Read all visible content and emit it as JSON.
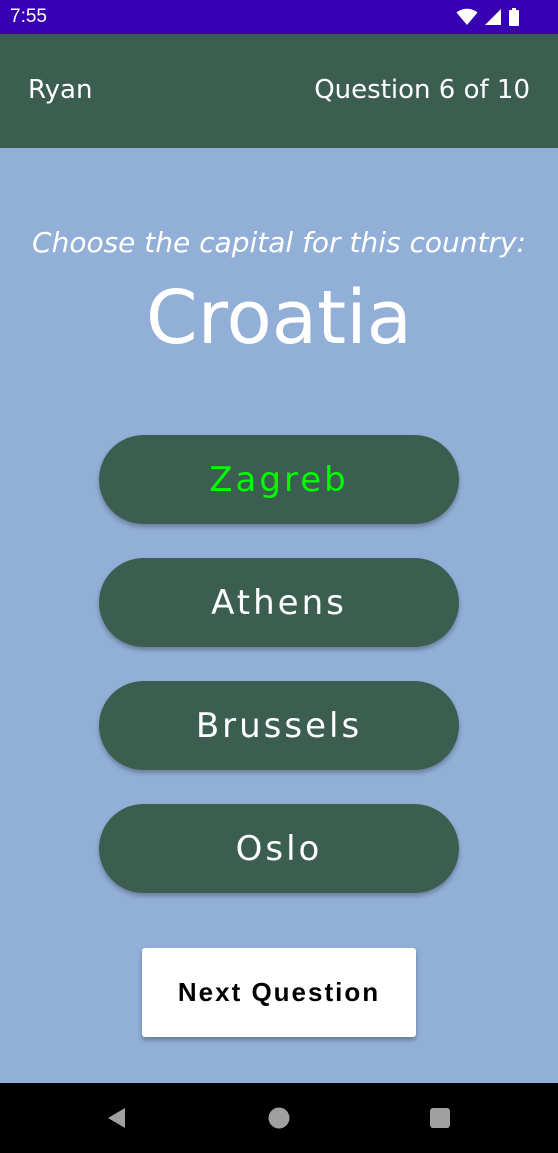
{
  "status_bar": {
    "time": "7:55",
    "icons": [
      "wifi-icon",
      "cell-signal-icon",
      "battery-icon"
    ]
  },
  "header": {
    "player_name": "Ryan",
    "progress": "Question 6 of 10"
  },
  "quiz": {
    "prompt": "Choose the capital for this country:",
    "country": "Croatia",
    "answers": [
      {
        "label": "Zagreb",
        "state": "correct"
      },
      {
        "label": "Athens",
        "state": "default"
      },
      {
        "label": "Brussels",
        "state": "default"
      },
      {
        "label": "Oslo",
        "state": "default"
      }
    ],
    "next_label": "Next Question"
  },
  "nav_bar": {
    "icons": [
      "back-icon",
      "home-icon",
      "recents-icon"
    ]
  },
  "colors": {
    "background": "#92afd7",
    "primary": "#3c5e50",
    "status_bar": "#3700b3",
    "correct_text": "#00ff00"
  }
}
